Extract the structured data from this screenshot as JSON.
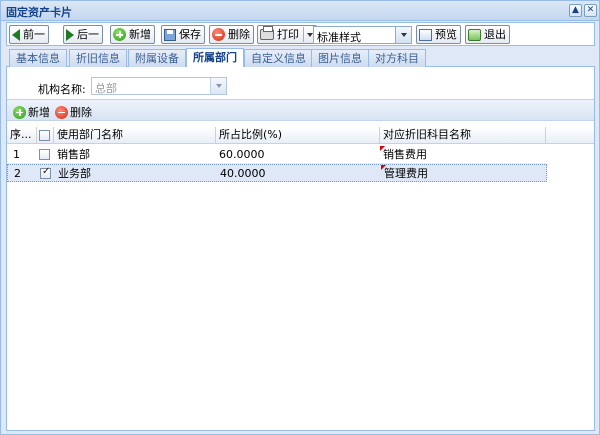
{
  "window": {
    "title": "固定资产卡片"
  },
  "toolbar": {
    "prev": "前一",
    "next": "后一",
    "add": "新增",
    "save": "保存",
    "delete": "删除",
    "print": "打印",
    "template": "标准样式",
    "preview": "预览",
    "exit": "退出"
  },
  "tabs": [
    "基本信息",
    "折旧信息",
    "附属设备",
    "所属部门",
    "自定义信息",
    "图片信息",
    "对方科目"
  ],
  "form": {
    "org_label": "机构名称:",
    "org_value": "总部"
  },
  "grid_toolbar": {
    "add": "新增",
    "delete": "删除"
  },
  "grid": {
    "columns": [
      "序...",
      "使用部门名称",
      "所占比例(%)",
      "对应折旧科目名称"
    ],
    "rows": [
      {
        "index": "1",
        "checked": false,
        "dept": "销售部",
        "ratio": "60.0000",
        "account": "销售费用"
      },
      {
        "index": "2",
        "checked": true,
        "dept": "业务部",
        "ratio": "40.0000",
        "account": "管理费用"
      }
    ]
  },
  "colors": {
    "border": "#99bbe8",
    "title": "#15428b",
    "selected_row": "#dfe8f6"
  }
}
